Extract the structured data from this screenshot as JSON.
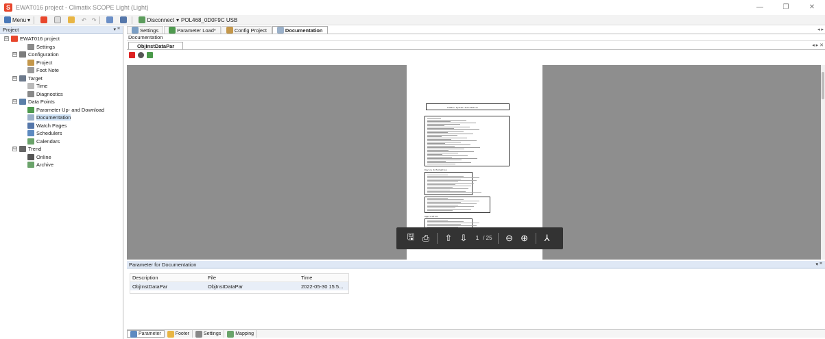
{
  "window": {
    "title": "EWAT016 project - Climatix SCOPE Light (Light)",
    "minimize": "—",
    "restore": "❐",
    "close": "✕"
  },
  "toolbar": {
    "menu_label": "Menu",
    "disconnect_label": "Disconnect",
    "connection": "POL468_0D0F9C USB"
  },
  "project_pane": {
    "title": "Project",
    "pin": "▾ ꟸ",
    "tree": [
      {
        "label": "EWAT016 project",
        "level": 0,
        "exp": "⊟",
        "color": "#e8462c"
      },
      {
        "label": "Settings",
        "level": 2,
        "exp": "",
        "color": "#8a8a8a"
      },
      {
        "label": "Configuration",
        "level": 1,
        "exp": "⊟",
        "color": "#7c7c7c"
      },
      {
        "label": "Project",
        "level": 2,
        "exp": "",
        "color": "#c4974a"
      },
      {
        "label": "Foot Note",
        "level": 2,
        "exp": "",
        "color": "#999999"
      },
      {
        "label": "Target",
        "level": 1,
        "exp": "⊟",
        "color": "#6d7a8c"
      },
      {
        "label": "Time",
        "level": 2,
        "exp": "",
        "color": "#bbbbbb"
      },
      {
        "label": "Diagnostics",
        "level": 2,
        "exp": "",
        "color": "#888888"
      },
      {
        "label": "Data Points",
        "level": 1,
        "exp": "⊟",
        "color": "#5b7fa8"
      },
      {
        "label": "Parameter Up- and Download",
        "level": 2,
        "exp": "",
        "color": "#4f9a4f"
      },
      {
        "label": "Documentation",
        "level": 2,
        "exp": "",
        "color": "#9ab0c9",
        "selected": true
      },
      {
        "label": "Watch Pages",
        "level": 2,
        "exp": "",
        "color": "#5577aa"
      },
      {
        "label": "Schedulers",
        "level": 2,
        "exp": "",
        "color": "#5d8ac0"
      },
      {
        "label": "Calendars",
        "level": 2,
        "exp": "",
        "color": "#6aa36a"
      },
      {
        "label": "Trend",
        "level": 1,
        "exp": "⊟",
        "color": "#666666"
      },
      {
        "label": "Online",
        "level": 2,
        "exp": "",
        "color": "#555555"
      },
      {
        "label": "Archive",
        "level": 2,
        "exp": "",
        "color": "#6aa36a"
      }
    ]
  },
  "tabs": [
    {
      "label": "Settings",
      "active": false
    },
    {
      "label": "Parameter Load*",
      "active": false
    },
    {
      "label": "Config Project",
      "active": false
    },
    {
      "label": "Documentation",
      "active": true
    }
  ],
  "tab_scroll": "◂ ▸",
  "documentation": {
    "section_label": "Documentation",
    "subtab": "ObjInstDataPar",
    "sub_scroll": "◂ ▸ ✕"
  },
  "pdf": {
    "heading": "Common System Information",
    "side_heading": "Device Information",
    "section_2": "Application",
    "page_current": "1",
    "page_total": "/ 25",
    "save": "🖫",
    "print": "⎙",
    "prev": "⇧",
    "next": "⇩",
    "zoom_out": "⊖",
    "zoom_in": "⊕",
    "acrobat": "⅄"
  },
  "param_panel": {
    "title": "Parameter for Documentation",
    "pin": "▾ ꟸ",
    "columns": [
      "Description",
      "File",
      "Time"
    ],
    "rows": [
      {
        "description": "ObjInstDataPar",
        "file": "ObjInstDataPar",
        "time": "2022-05-30 15:5..."
      }
    ]
  },
  "bottom_tabs": [
    {
      "label": "Parameter",
      "active": true
    },
    {
      "label": "Footer",
      "active": false
    },
    {
      "label": "Settings",
      "active": false
    },
    {
      "label": "Mapping",
      "active": false
    }
  ],
  "colors": {
    "accent": "#e8462c",
    "panel_header": "#dfe8f5",
    "viewer_bg": "#8e8e8e"
  }
}
